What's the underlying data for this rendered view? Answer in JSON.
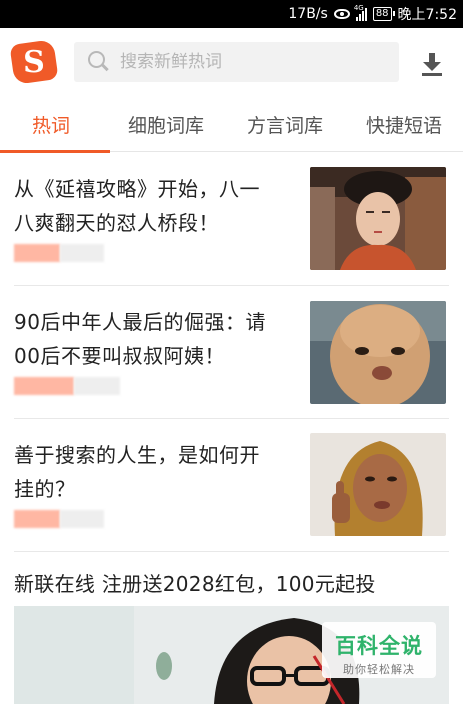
{
  "status_bar": {
    "speed": "17B/s",
    "network": "4G",
    "battery": "88",
    "time": "晚上7:52"
  },
  "header": {
    "logo": {
      "letter": "S",
      "icon": "sogou-logo"
    },
    "search": {
      "placeholder": "搜索新鲜热词",
      "icon": "search-icon"
    },
    "download_icon": "download-icon"
  },
  "tabs": [
    {
      "label": "热词",
      "active": true
    },
    {
      "label": "细胞词库",
      "active": false
    },
    {
      "label": "方言词库",
      "active": false
    },
    {
      "label": "快捷短语",
      "active": false
    }
  ],
  "feed": [
    {
      "title_line1": "从《延禧攻略》开始，八一",
      "title_line2": "八爽翻天的怼人桥段！",
      "thumb": "palace-drama-woman"
    },
    {
      "title_line1": "90后中年人最后的倔强：请",
      "title_line2": "00后不要叫叔叔阿姨！",
      "thumb": "bald-man-face"
    },
    {
      "title_line1": "善于搜索的人生，是如何开",
      "title_line2": "挂的？",
      "thumb": "woman-thumbs-up"
    }
  ],
  "ad": {
    "title": "新联在线 注册送2028红包，100元起投"
  },
  "watermark": {
    "title": "百科全说",
    "subtitle": "助你轻松解决"
  },
  "colors": {
    "accent": "#f05a28",
    "watermark_green": "#2fb36b",
    "text": "#222222"
  }
}
